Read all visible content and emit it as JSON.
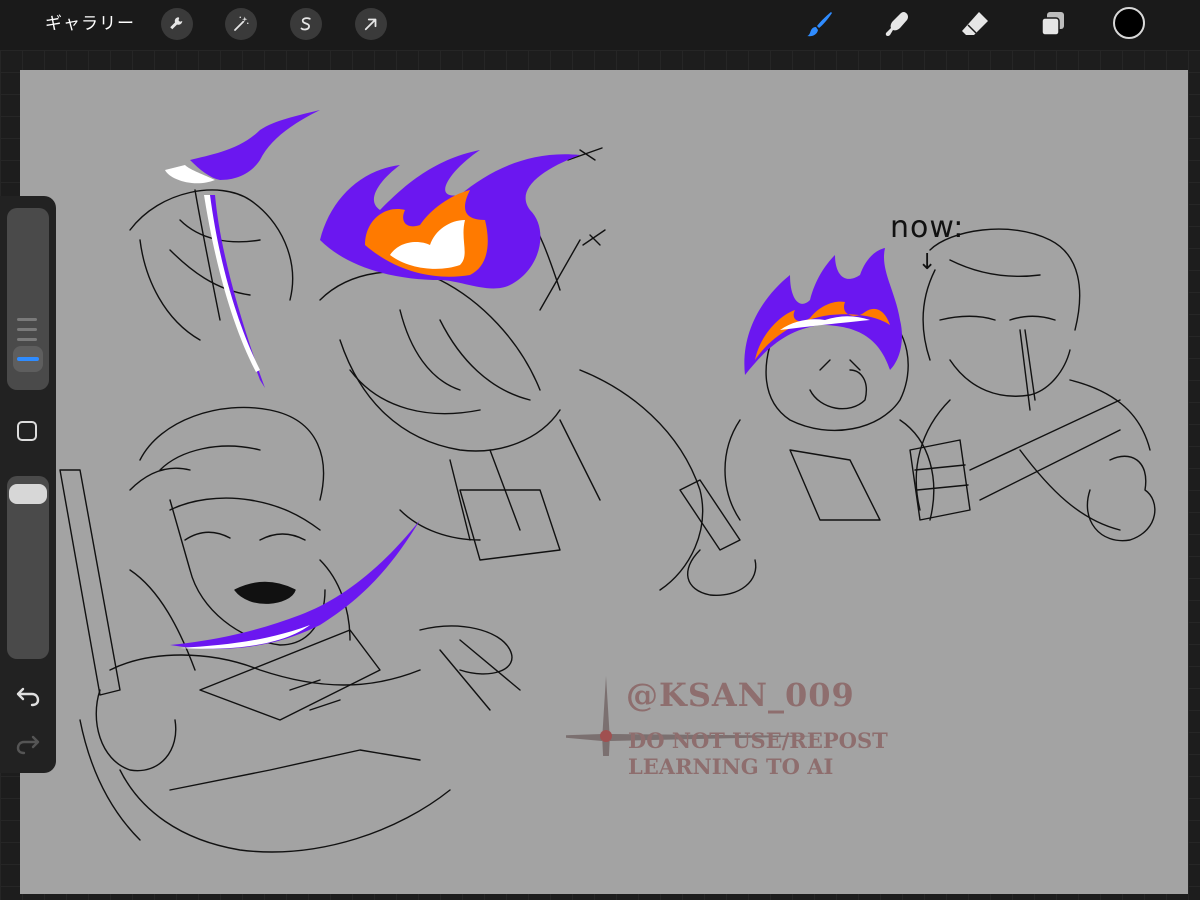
{
  "toolbar": {
    "gallery_label": "ギャラリー",
    "left_tools": [
      {
        "name": "actions",
        "icon": "wrench-icon"
      },
      {
        "name": "adjustments",
        "icon": "magic-wand-icon"
      },
      {
        "name": "selection",
        "icon": "selection-s-icon"
      },
      {
        "name": "transform",
        "icon": "arrow-cursor-icon"
      }
    ],
    "right_tools": [
      {
        "name": "brush",
        "icon": "brush-icon",
        "active": true
      },
      {
        "name": "smudge",
        "icon": "smudge-icon",
        "active": false
      },
      {
        "name": "eraser",
        "icon": "eraser-icon",
        "active": false
      },
      {
        "name": "layers",
        "icon": "layers-icon",
        "active": false
      }
    ],
    "current_color": "#000000",
    "accent_color": "#2f8cff"
  },
  "sidebar": {
    "size_slider": {
      "icon": "size-slider"
    },
    "modify_button": {
      "icon": "square-icon"
    },
    "opacity_slider": {
      "level": 1.0
    },
    "undo": {
      "icon": "undo-icon"
    },
    "redo": {
      "icon": "redo-icon"
    }
  },
  "canvas": {
    "background": "#a3a3a3",
    "note_text": "now:",
    "note_arrow": "↓",
    "watermark": {
      "handle": "@KSAN_009",
      "line1": "DO NOT USE/REPOST",
      "line2": "LEARNING TO AI"
    },
    "fire_colors": {
      "outer": "#6b17f0",
      "middle": "#ff7a00",
      "inner": "#ffffff"
    }
  }
}
